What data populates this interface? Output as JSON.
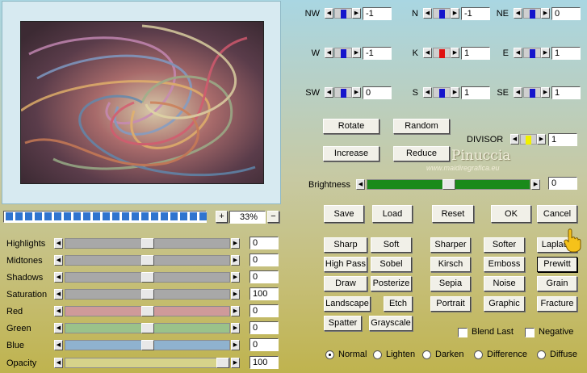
{
  "preview": {
    "zoom_value": "33%",
    "zoom_plus": "+",
    "zoom_minus": "−",
    "progress_fraction": 1.0
  },
  "matrix": {
    "cells": [
      {
        "label": "NW",
        "value": "-1",
        "thumb": 0.5,
        "thumb_color": "#1515cc"
      },
      {
        "label": "N",
        "value": "-1",
        "thumb": 0.5,
        "thumb_color": "#1515cc"
      },
      {
        "label": "NE",
        "value": "0",
        "thumb": 0.5,
        "thumb_color": "#1515cc"
      },
      {
        "label": "W",
        "value": "-1",
        "thumb": 0.5,
        "thumb_color": "#1515cc"
      },
      {
        "label": "K",
        "value": "1",
        "thumb": 0.5,
        "thumb_color": "#e01010"
      },
      {
        "label": "E",
        "value": "1",
        "thumb": 0.5,
        "thumb_color": "#1515cc"
      },
      {
        "label": "SW",
        "value": "0",
        "thumb": 0.5,
        "thumb_color": "#1515cc"
      },
      {
        "label": "S",
        "value": "1",
        "thumb": 0.5,
        "thumb_color": "#1515cc"
      },
      {
        "label": "SE",
        "value": "1",
        "thumb": 0.5,
        "thumb_color": "#1515cc"
      }
    ]
  },
  "buttons": {
    "rotate": "Rotate",
    "random": "Random",
    "increase": "Increase",
    "reduce": "Reduce",
    "save": "Save",
    "load": "Load",
    "reset": "Reset",
    "ok": "OK",
    "cancel": "Cancel"
  },
  "divisor": {
    "label": "DIVISOR",
    "value": "1",
    "thumb": 0.5,
    "thumb_color": "#f0f000"
  },
  "brightness": {
    "label": "Brightness",
    "value": "0",
    "level": 0.5
  },
  "watermark": {
    "title": "Pinuccia",
    "url": "www.maidiregrafica.eu"
  },
  "presets": [
    "Sharp",
    "Soft",
    "Sharper",
    "Softer",
    "Laplace",
    "High Pass",
    "Sobel",
    "Kirsch",
    "Emboss",
    "Prewitt",
    "Draw",
    "Posterize",
    "Sepia",
    "Noise",
    "Grain",
    "Landscape",
    "Etch",
    "Portrait",
    "Graphic",
    "Fracture",
    "Spatter",
    "Grayscale"
  ],
  "adjustments": [
    {
      "label": "Highlights",
      "value": "0",
      "level": 0.5,
      "color": "#a8a8a8"
    },
    {
      "label": "Midtones",
      "value": "0",
      "level": 0.5,
      "color": "#a8a8a8"
    },
    {
      "label": "Shadows",
      "value": "0",
      "level": 0.5,
      "color": "#a8a8a8"
    },
    {
      "label": "Saturation",
      "value": "100",
      "level": 0.5,
      "color": "#a8a8a8"
    },
    {
      "label": "Red",
      "value": "0",
      "level": 0.5,
      "color": "#cf9a9a"
    },
    {
      "label": "Green",
      "value": "0",
      "level": 0.5,
      "color": "#9ac28a"
    },
    {
      "label": "Blue",
      "value": "0",
      "level": 0.5,
      "color": "#8fb2cf"
    },
    {
      "label": "Opacity",
      "value": "100",
      "level": 1.0,
      "color": "#d6d38a"
    }
  ],
  "options": {
    "blend_last": "Blend Last",
    "negative": "Negative"
  },
  "modes": [
    {
      "label": "Normal",
      "selected": true
    },
    {
      "label": "Lighten",
      "selected": false
    },
    {
      "label": "Darken",
      "selected": false
    },
    {
      "label": "Difference",
      "selected": false
    },
    {
      "label": "Diffuse",
      "selected": false
    }
  ],
  "colors": {
    "accent_green": "#1a8a1a",
    "progress_blue": "#2f74cf"
  }
}
